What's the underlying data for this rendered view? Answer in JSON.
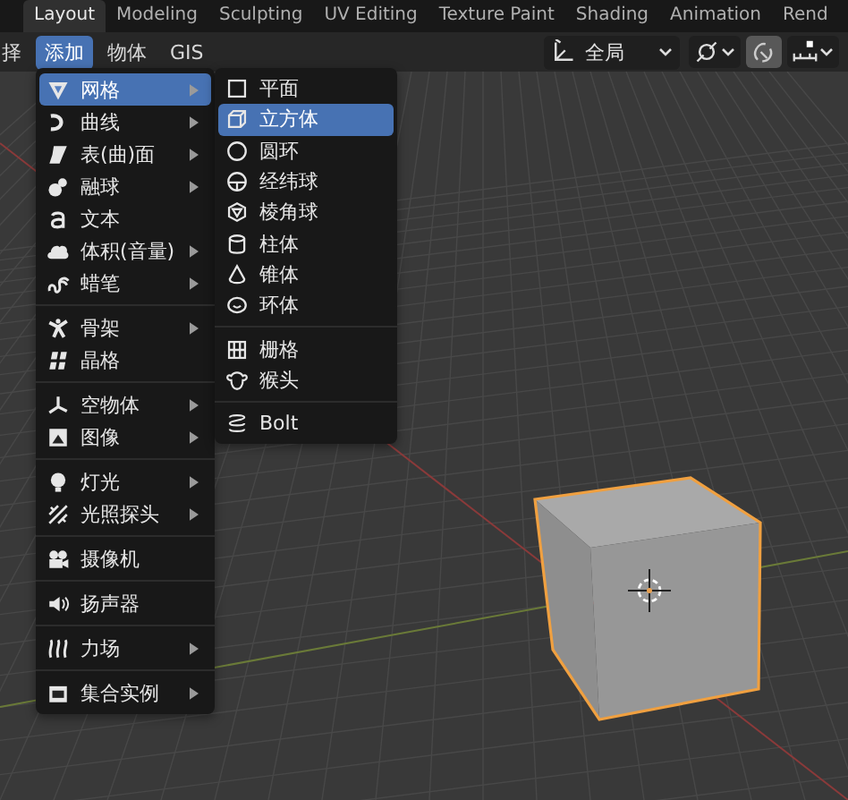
{
  "workspace_tabs": [
    {
      "label": "Layout",
      "selected": true
    },
    {
      "label": "Modeling",
      "selected": false
    },
    {
      "label": "Sculpting",
      "selected": false
    },
    {
      "label": "UV Editing",
      "selected": false
    },
    {
      "label": "Texture Paint",
      "selected": false
    },
    {
      "label": "Shading",
      "selected": false
    },
    {
      "label": "Animation",
      "selected": false
    },
    {
      "label": "Rend",
      "selected": false
    }
  ],
  "header": {
    "menus": [
      {
        "label": "择",
        "selected": false
      },
      {
        "label": "添加",
        "selected": true
      },
      {
        "label": "物体",
        "selected": false
      },
      {
        "label": "GIS",
        "selected": false
      }
    ],
    "orientation": "全局",
    "snap_on": true
  },
  "add_menu": {
    "groups": [
      [
        {
          "label": "网格",
          "submenu": true,
          "selected": true
        },
        {
          "label": "曲线",
          "submenu": true,
          "selected": false
        },
        {
          "label": "表(曲)面",
          "submenu": true,
          "selected": false
        },
        {
          "label": "融球",
          "submenu": true,
          "selected": false
        },
        {
          "label": "文本",
          "submenu": false,
          "selected": false
        },
        {
          "label": "体积(音量)",
          "submenu": true,
          "selected": false
        },
        {
          "label": "蜡笔",
          "submenu": true,
          "selected": false
        }
      ],
      [
        {
          "label": "骨架",
          "submenu": true,
          "selected": false
        },
        {
          "label": "晶格",
          "submenu": false,
          "selected": false
        }
      ],
      [
        {
          "label": "空物体",
          "submenu": true,
          "selected": false
        },
        {
          "label": "图像",
          "submenu": true,
          "selected": false
        }
      ],
      [
        {
          "label": "灯光",
          "submenu": true,
          "selected": false
        },
        {
          "label": "光照探头",
          "submenu": true,
          "selected": false
        }
      ],
      [
        {
          "label": "摄像机",
          "submenu": false,
          "selected": false
        }
      ],
      [
        {
          "label": "扬声器",
          "submenu": false,
          "selected": false
        }
      ],
      [
        {
          "label": "力场",
          "submenu": true,
          "selected": false
        }
      ],
      [
        {
          "label": "集合实例",
          "submenu": true,
          "selected": false
        }
      ]
    ]
  },
  "mesh_menu": {
    "groups": [
      [
        {
          "label": "平面",
          "selected": false
        },
        {
          "label": "立方体",
          "selected": true
        },
        {
          "label": "圆环",
          "selected": false
        },
        {
          "label": "经纬球",
          "selected": false
        },
        {
          "label": "棱角球",
          "selected": false
        },
        {
          "label": "柱体",
          "selected": false
        },
        {
          "label": "锥体",
          "selected": false
        },
        {
          "label": "环体",
          "selected": false
        }
      ],
      [
        {
          "label": "栅格",
          "selected": false
        },
        {
          "label": "猴头",
          "selected": false
        }
      ],
      [
        {
          "label": "Bolt",
          "selected": false
        }
      ]
    ]
  }
}
